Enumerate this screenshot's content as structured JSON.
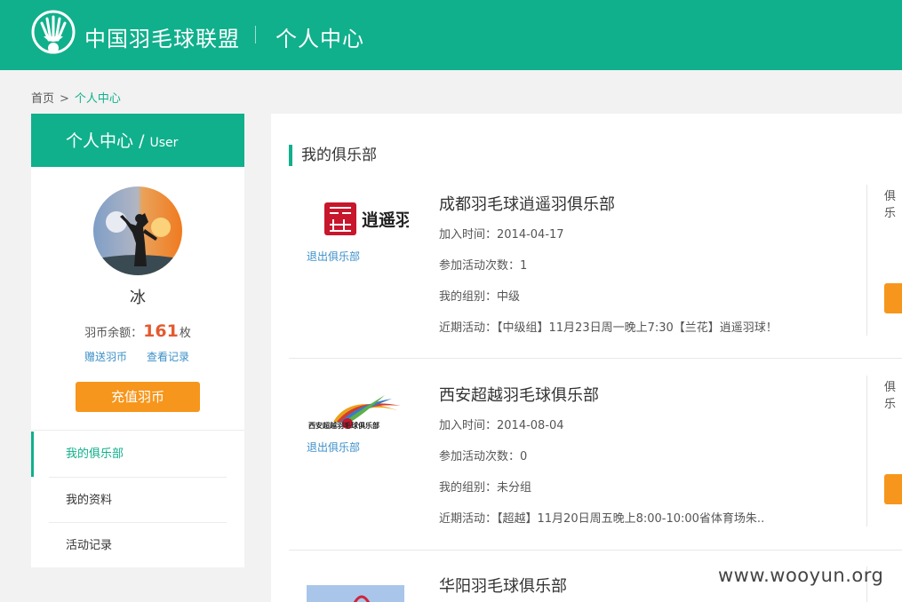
{
  "header": {
    "site_name": "中国羽毛球联盟",
    "page_name": "个人中心"
  },
  "breadcrumb": {
    "home": "首页",
    "separator": ">",
    "current": "个人中心"
  },
  "sidebar": {
    "title": "个人中心",
    "slash": "/",
    "title_en": "User",
    "username": "冰",
    "balance_label": "羽币余额：",
    "balance_value": "161",
    "balance_unit": "枚",
    "gift_link": "赠送羽币",
    "records_link": "查看记录",
    "recharge_button": "充值羽币",
    "menu": [
      {
        "label": "我的俱乐部"
      },
      {
        "label": "我的资料"
      },
      {
        "label": "活动记录"
      }
    ]
  },
  "main": {
    "section_title": "我的俱乐部",
    "quit_label": "退出俱乐部",
    "side_label": "俱乐",
    "clubs": [
      {
        "name": "成都羽毛球逍遥羽俱乐部",
        "logo_text": "逍遥羽",
        "joined": "加入时间：2014-04-17",
        "activity_count": "参加活动次数：1",
        "group": "我的组别：中级",
        "recent": "近期活动：【中级组】11月23日周一晚上7:30【兰花】逍遥羽球！"
      },
      {
        "name": "西安超越羽毛球俱乐部",
        "logo_text": "西安超越羽毛球俱乐部",
        "joined": "加入时间：2014-08-04",
        "activity_count": "参加活动次数：0",
        "group": "我的组别：未分组",
        "recent": "近期活动：【超越】11月20日周五晚上8:00-10:00省体育场朱.."
      },
      {
        "name": "华阳羽毛球俱乐部"
      }
    ]
  },
  "watermark": "www.wooyun.org",
  "colors": {
    "brand_green": "#10b08c",
    "accent_orange": "#f7961c",
    "coin_red": "#e45a2f",
    "link_blue": "#3b8fc8"
  }
}
